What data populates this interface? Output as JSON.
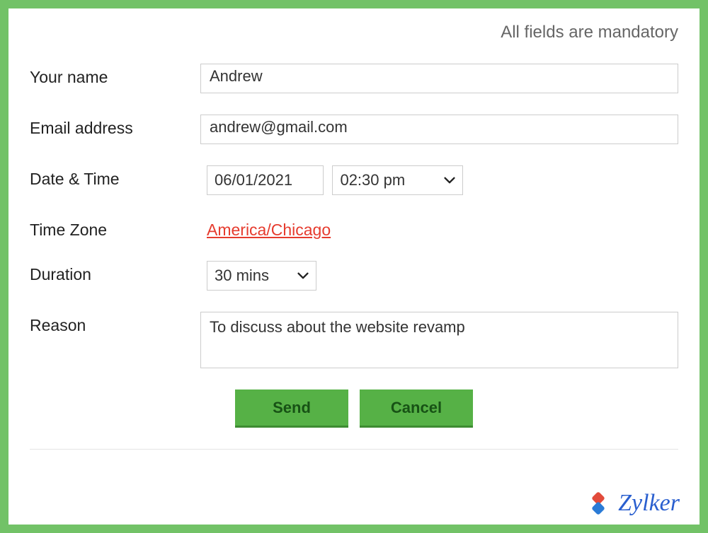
{
  "header": {
    "mandatory_note": "All fields are mandatory"
  },
  "form": {
    "name": {
      "label": "Your name",
      "value": "Andrew"
    },
    "email": {
      "label": "Email address",
      "value": "andrew@gmail.com"
    },
    "datetime": {
      "label": "Date & Time",
      "date_value": "06/01/2021",
      "time_value": "02:30 pm"
    },
    "timezone": {
      "label": "Time Zone",
      "value": "America/Chicago"
    },
    "duration": {
      "label": "Duration",
      "value": "30 mins"
    },
    "reason": {
      "label": "Reason",
      "value": "To discuss about the website revamp"
    }
  },
  "buttons": {
    "send": "Send",
    "cancel": "Cancel"
  },
  "branding": {
    "name": "Zylker"
  }
}
